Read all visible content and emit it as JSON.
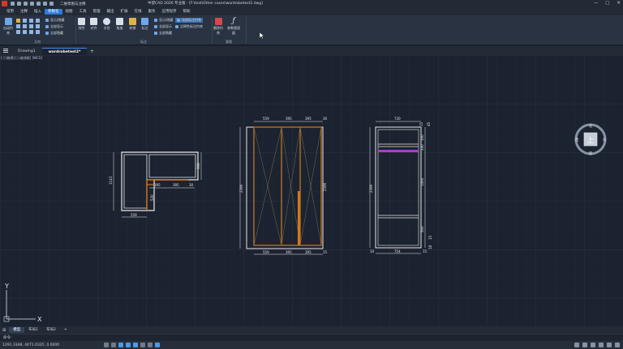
{
  "titlebar": {
    "workspace": "二维草图与注释",
    "title": "中望CAD 2026 专业版 - [F:\\test\\Other cases\\wardrobetest2.dwg]",
    "window_buttons": [
      "—",
      "▢",
      "✕"
    ]
  },
  "menu": {
    "tabs": [
      "常用",
      "注释",
      "插入",
      "参数化",
      "视图",
      "工具",
      "管理",
      "输出",
      "扩展",
      "在线",
      "服务",
      "应用程序",
      "帮助"
    ],
    "active_index": 3
  },
  "ribbon": {
    "geometry_group": {
      "label": "几何",
      "main_button": "自动约束",
      "small": [
        "显示/隐藏",
        "全部显示",
        "全部隐藏"
      ]
    },
    "dimension_group": {
      "label": "标注",
      "buttons": [
        "线性",
        "对齐",
        "半径",
        "角度",
        "转换",
        "标注"
      ],
      "small": [
        "显示/隐藏",
        "全部显示",
        "全部隐藏",
        "动态标注约束",
        "注释性标注约束"
      ]
    },
    "manage_group": {
      "label": "管理",
      "buttons": [
        "删除约束",
        "参数管理器"
      ]
    }
  },
  "doc_tabs": {
    "tabs": [
      "Drawing1",
      "wardrobetest2*"
    ],
    "active_index": 1,
    "add": "+"
  },
  "viewport": {
    "label": "[-] [俯视] [二维线框] [WCS]",
    "viewcube": {
      "top": "上",
      "n": "北",
      "s": "南",
      "e": "东",
      "w": "西"
    },
    "ucs": {
      "x": "X",
      "y": "Y"
    },
    "plan_dims": {
      "width_bottom": "559",
      "height_left": "1143",
      "height_right": "308",
      "inner_1": "395",
      "inner_2": "395",
      "inner_3": "30",
      "small_v": "530"
    },
    "front_dims": {
      "top": [
        "559",
        "395",
        "395",
        "30"
      ],
      "bottom": [
        "559",
        "395",
        "395",
        "15"
      ],
      "height_left": "2390",
      "height_right": "2390"
    },
    "side_dims": {
      "top": "730",
      "top_small": [
        "15",
        "45"
      ],
      "bottom": "754",
      "bottom_small": [
        "10",
        "15"
      ],
      "height_left": "2390",
      "right": [
        "100",
        "330",
        "1400",
        "500",
        "15",
        "18"
      ]
    }
  },
  "layout_tabs": {
    "tabs": [
      "模型",
      "布局1",
      "布局2"
    ],
    "active_index": 0,
    "add": "+"
  },
  "command": {
    "prompt": "命令:"
  },
  "status": {
    "coords": "1291.3348, 4471.0335, 0.0000"
  },
  "colors": {
    "accent": "#2f7ad6",
    "wardrobe_orange": "#d07a1c",
    "rail_magenta": "#b03cc8",
    "line_white": "#e8e8e8",
    "drawing_bg": "#1c2330"
  }
}
